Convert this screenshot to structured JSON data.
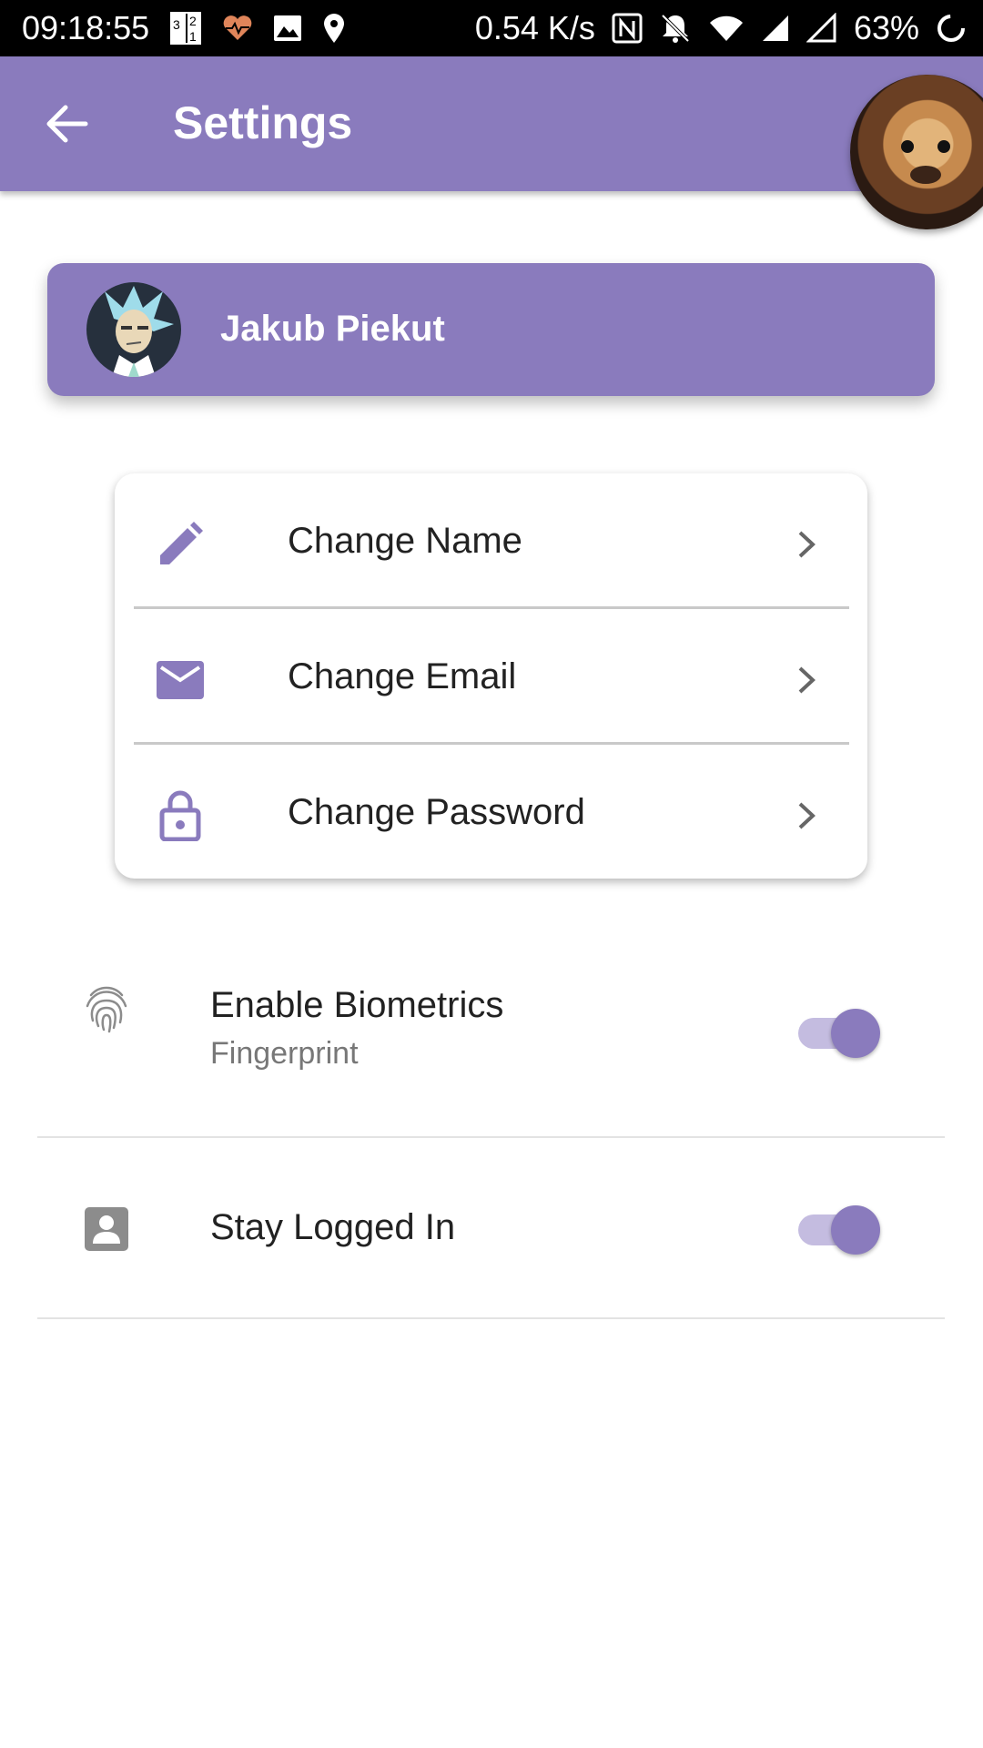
{
  "status_bar": {
    "time": "09:18:55",
    "net_speed": "0.54 K/s",
    "battery": "63%",
    "icons_left": [
      "sim-calendar-icon",
      "heart-pulse-icon",
      "image-icon",
      "location-pin-icon"
    ],
    "icons_right": [
      "nfc-icon",
      "bell-off-icon",
      "wifi-icon",
      "signal-icon",
      "signal-empty-icon",
      "loading-ring-icon"
    ]
  },
  "app_bar": {
    "title": "Settings",
    "back_icon": "arrow-back-icon",
    "background": "#8a7bbd"
  },
  "profile": {
    "name": "Jakub Piekut",
    "avatar_icon": "cartoon-avatar"
  },
  "options": [
    {
      "label": "Change Name",
      "icon": "pencil-icon"
    },
    {
      "label": "Change Email",
      "icon": "mail-icon"
    },
    {
      "label": "Change Password",
      "icon": "lock-icon"
    }
  ],
  "settings": [
    {
      "title": "Enable Biometrics",
      "subtitle": "Fingerprint",
      "icon": "fingerprint-icon",
      "enabled": true
    },
    {
      "title": "Stay Logged In",
      "icon": "account-box-icon",
      "enabled": true
    }
  ],
  "colors": {
    "accent": "#8a7bbd",
    "toggle_track": "#c4bce0",
    "icon_purple": "#8a7bbd",
    "icon_grey": "#888888"
  }
}
